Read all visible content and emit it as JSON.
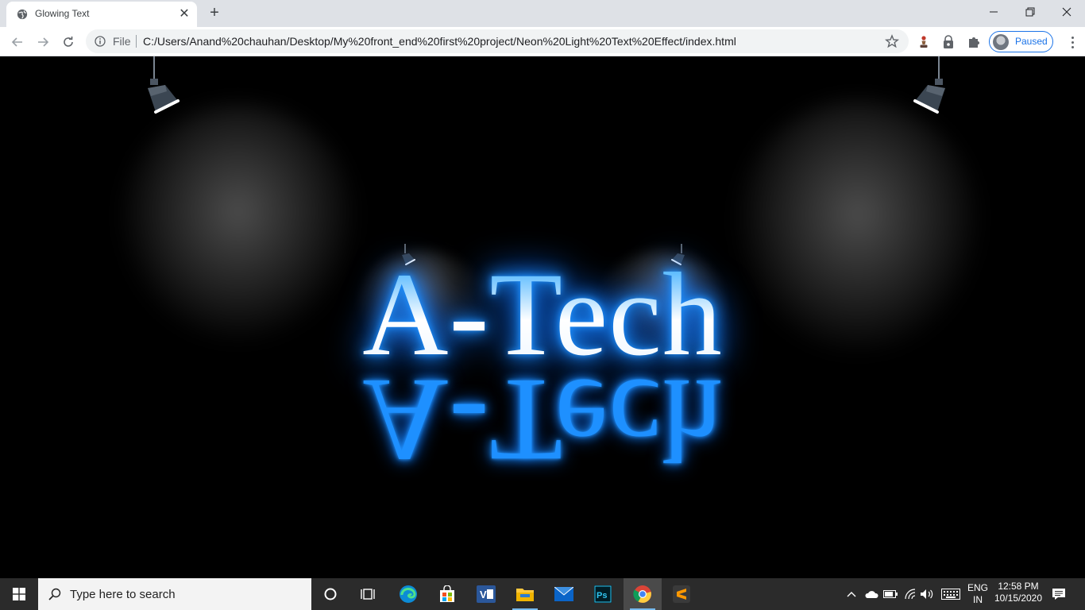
{
  "browser": {
    "tab": {
      "title": "Glowing Text",
      "favicon": "globe-icon",
      "close": "✕"
    },
    "new_tab": "+",
    "window_controls": {
      "minimize": "minimize-icon",
      "restore": "restore-icon",
      "close": "close-icon"
    },
    "toolbar": {
      "back": "back-arrow-icon",
      "forward": "forward-arrow-icon",
      "reload": "reload-icon",
      "site_info": "info-icon",
      "scheme_label": "File",
      "url": "C:/Users/Anand%20chauhan/Desktop/My%20front_end%20first%20project/Neon%20Light%20Text%20Effect/index.html",
      "bookmark": "star-icon",
      "extensions": [
        "chess-pawn-icon",
        "lock-bag-icon",
        "puzzle-icon"
      ],
      "profile_label": "Paused",
      "menu": "three-dots-icon"
    }
  },
  "page": {
    "heading": "A-Tech",
    "reflection": "A-Tech",
    "neon_color": "#1e90ff",
    "background": "#000000",
    "spotlights": [
      "spotlight-large-left",
      "spotlight-large-right",
      "spotlight-small-left",
      "spotlight-small-right"
    ]
  },
  "taskbar": {
    "search_placeholder": "Type here to search",
    "pinned": [
      "cortana-icon",
      "task-view-icon",
      "edge-icon",
      "store-icon",
      "visual-studio-icon",
      "file-explorer-icon",
      "mail-icon",
      "photoshop-icon",
      "chrome-icon",
      "sublime-text-icon"
    ],
    "active_app": "chrome-icon",
    "tray": {
      "language_top": "ENG",
      "language_bottom": "IN",
      "time": "12:58 PM",
      "date": "10/15/2020"
    }
  }
}
